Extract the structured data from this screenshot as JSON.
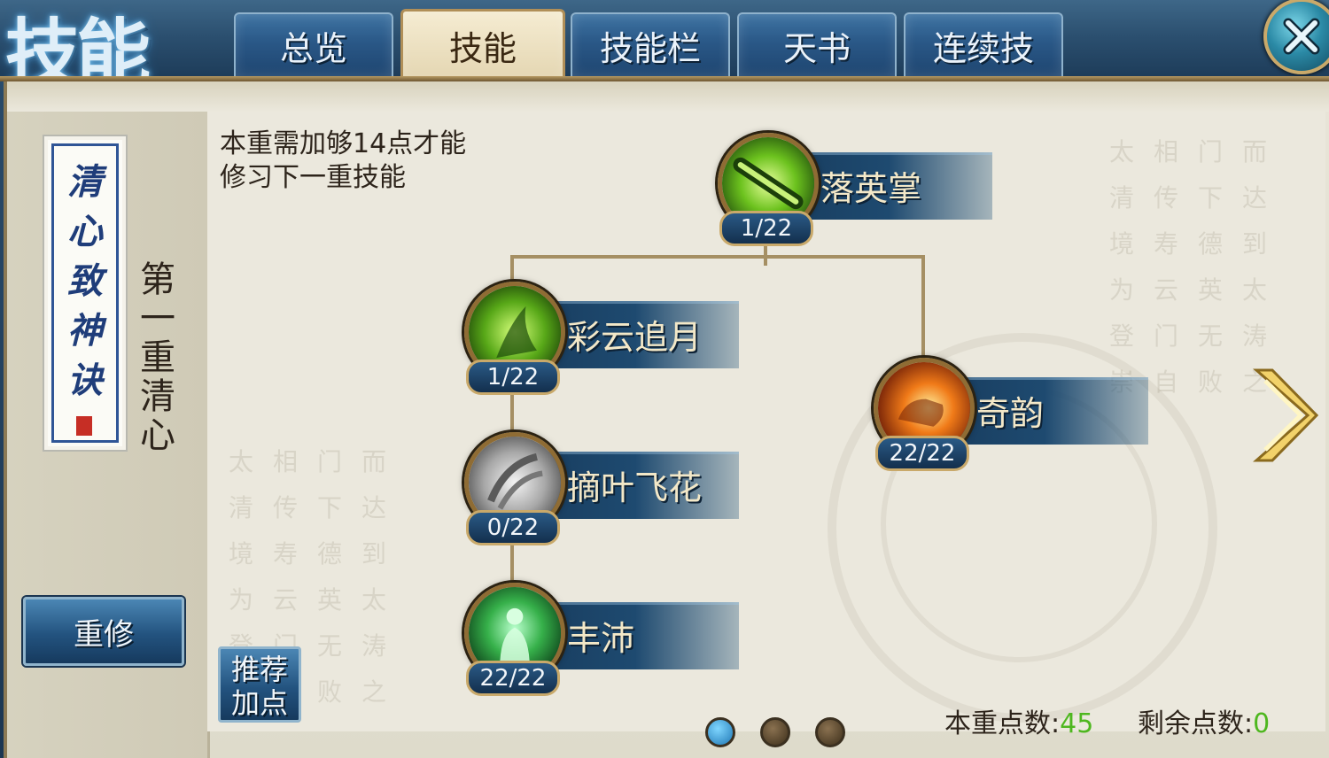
{
  "header": {
    "title": "技能",
    "tabs": [
      {
        "label": "总览",
        "active": false
      },
      {
        "label": "技能",
        "active": true
      },
      {
        "label": "技能栏",
        "active": false
      },
      {
        "label": "天书",
        "active": false
      },
      {
        "label": "连续技",
        "active": false
      }
    ]
  },
  "sidebar": {
    "scroll_title": "清心致神诀",
    "layer_label": "第一重清心",
    "rebuild_button": "重修"
  },
  "info_text": "本重需加够14点才能修习下一重技能",
  "skills": [
    {
      "name": "落英掌",
      "level": "1/22",
      "icon": "green-palm-strike-icon"
    },
    {
      "name": "彩云追月",
      "level": "1/22",
      "icon": "green-rushing-figure-icon"
    },
    {
      "name": "奇韵",
      "level": "22/22",
      "icon": "fiery-fist-icon"
    },
    {
      "name": "摘叶飞花",
      "level": "0/22",
      "icon": "gray-flying-leaves-icon"
    },
    {
      "name": "丰沛",
      "level": "22/22",
      "icon": "green-meditating-figure-icon"
    }
  ],
  "recommend_button": "推荐加点",
  "footer": {
    "layer_points_label": "本重点数:",
    "layer_points_value": "45",
    "remaining_points_label": "剩余点数:",
    "remaining_points_value": "0",
    "page_count": 3,
    "current_page": 1
  },
  "colors": {
    "accent_gold": "#c9a96a",
    "tab_blue": "#2a5887",
    "parchment": "#ebe8dd",
    "points_green": "#4eb71f"
  }
}
